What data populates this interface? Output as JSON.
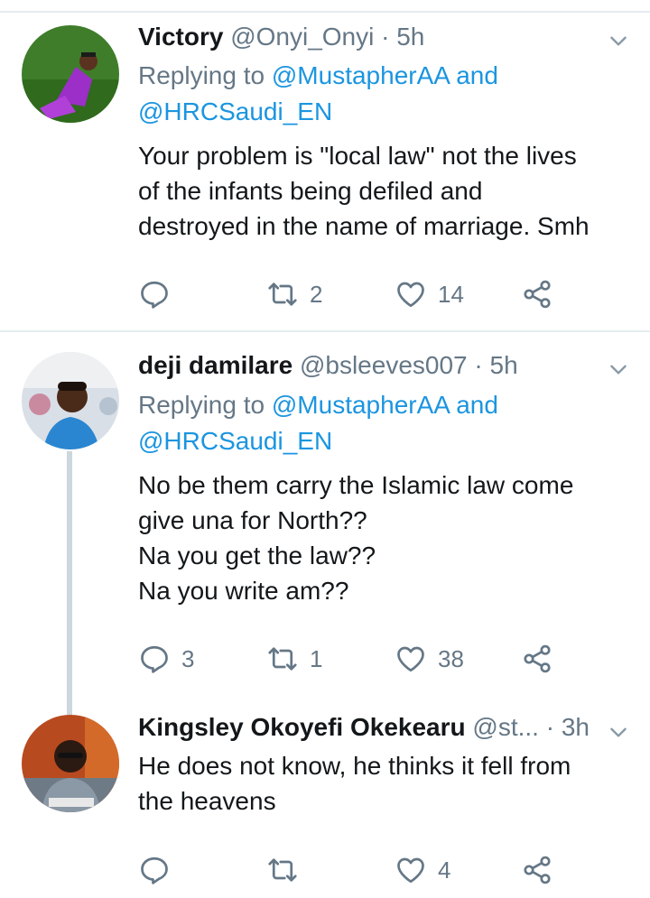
{
  "tweets": [
    {
      "name": "Victory",
      "handle": "@Onyi_Onyi",
      "dot": "·",
      "time": "5h",
      "reply_prefix": "Replying to",
      "mention1": "@MustapherAA",
      "reply_and": "and",
      "mention2": "@HRCSaudi_EN",
      "lines": [
        "Your problem is \"local law\" not the lives",
        "of the infants being defiled and",
        "destroyed in the name of marriage. Smh"
      ],
      "replies": "",
      "retweets": "2",
      "likes": "14"
    },
    {
      "name": "deji damilare",
      "handle": "@bsleeves007",
      "dot": "·",
      "time": "5h",
      "reply_prefix": "Replying to",
      "mention1": "@MustapherAA",
      "reply_and": "and",
      "mention2": "@HRCSaudi_EN",
      "lines": [
        "No be them carry the Islamic law come",
        "give una for North??",
        "Na you get the law??",
        "Na you write am??"
      ],
      "replies": "3",
      "retweets": "1",
      "likes": "38"
    },
    {
      "name": "Kingsley Okoyefi Okekearu",
      "handle": "@st...",
      "dot": "·",
      "time": "3h",
      "lines": [
        "He does not know, he thinks it fell from",
        "the heavens"
      ],
      "replies": "",
      "retweets": "",
      "likes": "4"
    }
  ],
  "colors": {
    "text": "#14171a",
    "muted": "#657786",
    "link": "#1b95e0",
    "divider": "#e6ecf0",
    "thread_line": "#ccd6dd"
  },
  "icons": [
    "reply-icon",
    "retweet-icon",
    "like-icon",
    "share-icon",
    "chevron-down-icon"
  ]
}
